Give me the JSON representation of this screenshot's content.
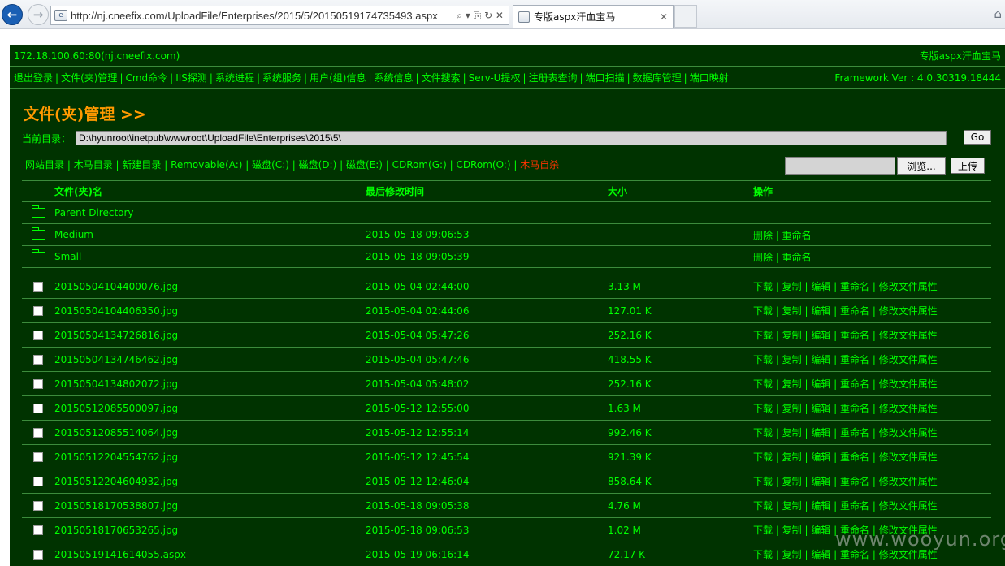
{
  "browser": {
    "url": "http://nj.cneefix.com/UploadFile/Enterprises/2015/5/20150519174735493.aspx",
    "tab_title": "专版aspx汗血宝马",
    "tab_close": "✕",
    "addr_buttons": "⌕ ▾ ⎘ ↻ ✕"
  },
  "header": {
    "server": "172.18.100.60:80(nj.cneefix.com)",
    "app_name": "专版aspx汗血宝马"
  },
  "menu": {
    "items": [
      "退出登录",
      "文件(夹)管理",
      "Cmd命令",
      "IIS探测",
      "系统进程",
      "系统服务",
      "用户(组)信息",
      "系统信息",
      "文件搜索",
      "Serv-U提权",
      "注册表查询",
      "端口扫描",
      "数据库管理",
      "端口映射"
    ],
    "framework": "Framework Ver : 4.0.30319.18444"
  },
  "section_title": "文件(夹)管理 >>",
  "current_dir": {
    "label": "当前目录：",
    "value": "D:\\hyunroot\\inetpub\\wwwroot\\UploadFile\\Enterprises\\2015\\5\\",
    "go_label": "Go"
  },
  "drives": [
    "网站目录",
    "木马目录",
    "新建目录",
    "Removable(A:)",
    "磁盘(C:)",
    "磁盘(D:)",
    "磁盘(E:)",
    "CDRom(G:)",
    "CDRom(O:)"
  ],
  "self_delete": "木马自杀",
  "upload": {
    "browse_label": "浏览...",
    "upload_label": "上传"
  },
  "table": {
    "headers": {
      "name": "文件(夹)名",
      "modified": "最后修改时间",
      "size": "大小",
      "actions": "操作"
    },
    "parent": "Parent Directory",
    "dirs": [
      {
        "name": "Medium",
        "modified": "2015-05-18 09:06:53",
        "size": "--",
        "actions": "删除 | 重命名"
      },
      {
        "name": "Small",
        "modified": "2015-05-18 09:05:39",
        "size": "--",
        "actions": "删除 | 重命名"
      }
    ],
    "files": [
      {
        "name": "20150504104400076.jpg",
        "modified": "2015-05-04 02:44:00",
        "size": "3.13 M",
        "actions": "下载 | 复制 | 编辑 | 重命名 | 修改文件属性"
      },
      {
        "name": "20150504104406350.jpg",
        "modified": "2015-05-04 02:44:06",
        "size": "127.01 K",
        "actions": "下载 | 复制 | 编辑 | 重命名 | 修改文件属性"
      },
      {
        "name": "20150504134726816.jpg",
        "modified": "2015-05-04 05:47:26",
        "size": "252.16 K",
        "actions": "下载 | 复制 | 编辑 | 重命名 | 修改文件属性"
      },
      {
        "name": "20150504134746462.jpg",
        "modified": "2015-05-04 05:47:46",
        "size": "418.55 K",
        "actions": "下载 | 复制 | 编辑 | 重命名 | 修改文件属性"
      },
      {
        "name": "20150504134802072.jpg",
        "modified": "2015-05-04 05:48:02",
        "size": "252.16 K",
        "actions": "下载 | 复制 | 编辑 | 重命名 | 修改文件属性"
      },
      {
        "name": "20150512085500097.jpg",
        "modified": "2015-05-12 12:55:00",
        "size": "1.63 M",
        "actions": "下载 | 复制 | 编辑 | 重命名 | 修改文件属性"
      },
      {
        "name": "20150512085514064.jpg",
        "modified": "2015-05-12 12:55:14",
        "size": "992.46 K",
        "actions": "下载 | 复制 | 编辑 | 重命名 | 修改文件属性"
      },
      {
        "name": "20150512204554762.jpg",
        "modified": "2015-05-12 12:45:54",
        "size": "921.39 K",
        "actions": "下载 | 复制 | 编辑 | 重命名 | 修改文件属性"
      },
      {
        "name": "20150512204604932.jpg",
        "modified": "2015-05-12 12:46:04",
        "size": "858.64 K",
        "actions": "下载 | 复制 | 编辑 | 重命名 | 修改文件属性"
      },
      {
        "name": "20150518170538807.jpg",
        "modified": "2015-05-18 09:05:38",
        "size": "4.76 M",
        "actions": "下载 | 复制 | 编辑 | 重命名 | 修改文件属性"
      },
      {
        "name": "20150518170653265.jpg",
        "modified": "2015-05-18 09:06:53",
        "size": "1.02 M",
        "actions": "下载 | 复制 | 编辑 | 重命名 | 修改文件属性"
      },
      {
        "name": "20150519141614055.aspx",
        "modified": "2015-05-19 06:16:14",
        "size": "72.17 K",
        "actions": "下载 | 复制 | 编辑 | 重命名 | 修改文件属性"
      }
    ]
  },
  "watermark": "www.wooyun.org",
  "colors": {
    "page_bg": "#003300",
    "text": "#00ff00",
    "title": "#ff9900",
    "danger": "#ff3300"
  }
}
